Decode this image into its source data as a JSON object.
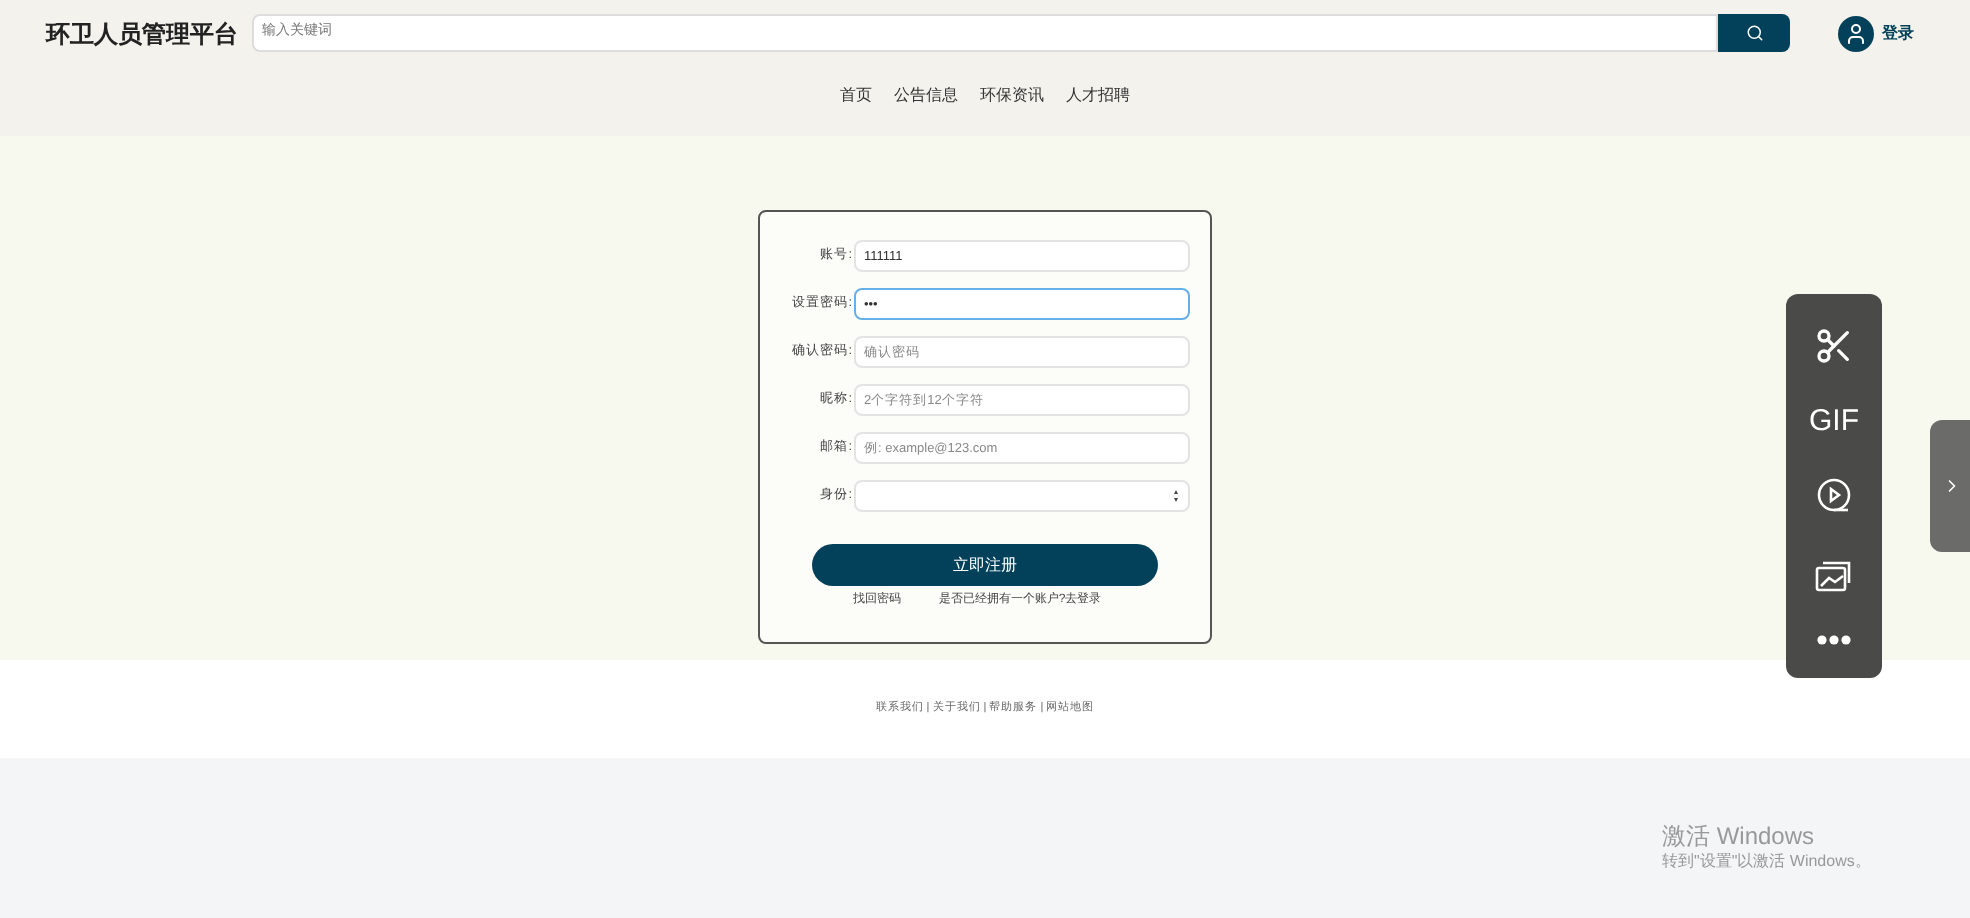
{
  "header": {
    "logo": "环卫人员管理平台",
    "search": {
      "placeholder": "输入关键词"
    },
    "login": "登录"
  },
  "nav": [
    "首页",
    "公告信息",
    "环保资讯",
    "人才招聘"
  ],
  "form": {
    "fields": [
      {
        "kind": "text",
        "label": "账号:",
        "value": "111111",
        "focused": false
      },
      {
        "kind": "text",
        "label": "设置密码:",
        "value": "•••",
        "focused": true
      },
      {
        "kind": "text",
        "label": "确认密码:",
        "placeholder": "确认密码",
        "focused": false
      },
      {
        "kind": "text",
        "label": "昵称:",
        "placeholder": "2个字符到12个字符",
        "focused": false
      },
      {
        "kind": "text",
        "label": "邮箱:",
        "placeholder": "例: example@123.com",
        "focused": false
      },
      {
        "kind": "select",
        "label": "身份:",
        "focused": false
      }
    ],
    "submit": "立即注册",
    "links": [
      "找回密码",
      "是否已经拥有一个账户?去登录"
    ]
  },
  "footer": "联系我们 | 关于我们 | 帮助服务 | 网站地图",
  "toolbar": [
    {
      "kind": "scissors"
    },
    {
      "kind": "gif",
      "label": "GIF"
    },
    {
      "kind": "record"
    },
    {
      "kind": "image"
    },
    {
      "kind": "more"
    }
  ],
  "activation": {
    "title": "激活 Windows",
    "subtitle": "转到\"设置\"以激活 Windows。"
  }
}
